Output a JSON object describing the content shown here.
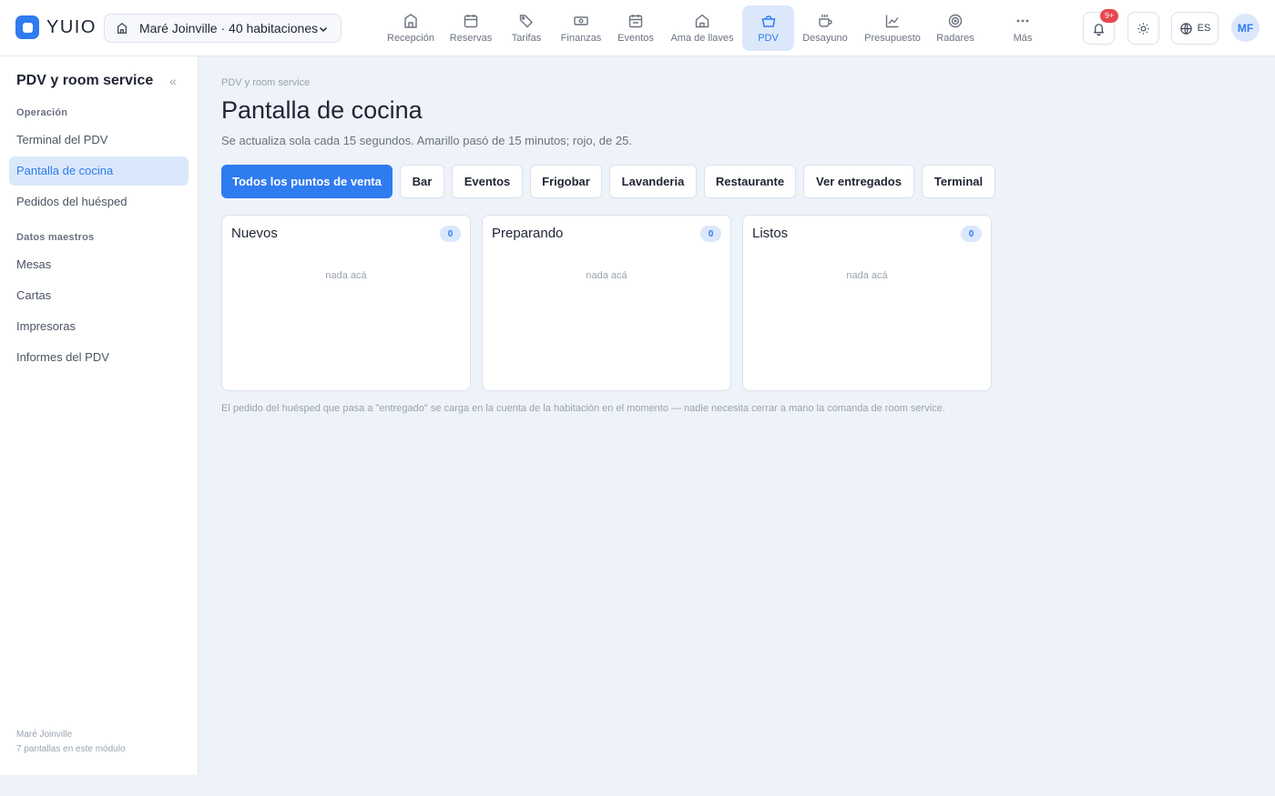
{
  "app": {
    "logo_text": "YUIO"
  },
  "hotel_selector": {
    "label": "Maré Joinville · 40 habitaciones"
  },
  "nav": [
    {
      "label": "Recepción",
      "icon": "building-icon"
    },
    {
      "label": "Reservas",
      "icon": "calendar-icon"
    },
    {
      "label": "Tarifas",
      "icon": "tag-icon"
    },
    {
      "label": "Finanzas",
      "icon": "banknote-icon"
    },
    {
      "label": "Eventos",
      "icon": "calendar-event-icon"
    },
    {
      "label": "Ama de llaves",
      "icon": "house-icon"
    },
    {
      "label": "PDV",
      "icon": "basket-icon",
      "active": true
    },
    {
      "label": "Desayuno",
      "icon": "coffee-icon"
    },
    {
      "label": "Presupuesto",
      "icon": "chart-line-icon"
    },
    {
      "label": "Radares",
      "icon": "target-icon"
    },
    {
      "label": "Más",
      "icon": "dots-icon"
    }
  ],
  "header_actions": {
    "notifications_badge": "9+",
    "language": "ES",
    "avatar_initials": "MF"
  },
  "sidebar": {
    "title": "PDV y room service",
    "collapse_glyph": "«",
    "sections": [
      {
        "heading": "Operación",
        "items": [
          "Terminal del PDV",
          "Pantalla de cocina",
          "Pedidos del huésped"
        ]
      },
      {
        "heading": "Datos maestros",
        "items": [
          "Mesas",
          "Cartas",
          "Impresoras",
          "Informes del PDV"
        ]
      }
    ],
    "active_item": "Pantalla de cocina",
    "footer": {
      "hotel": "Maré Joinville",
      "screens": "7 pantallas en este módulo"
    }
  },
  "main": {
    "breadcrumb": "PDV y room service",
    "title": "Pantalla de cocina",
    "subtitle": "Se actualiza sola cada 15 segundos. Amarillo pasó de 15 minutos; rojo, de 25.",
    "filters": [
      "Todos los puntos de venta",
      "Bar",
      "Eventos",
      "Frigobar",
      "Lavanderia",
      "Restaurante",
      "Ver entregados",
      "Terminal"
    ],
    "active_filter": "Todos los puntos de venta",
    "columns": [
      {
        "title": "Nuevos",
        "count": "0",
        "empty_text": "nada acá"
      },
      {
        "title": "Preparando",
        "count": "0",
        "empty_text": "nada acá"
      },
      {
        "title": "Listos",
        "count": "0",
        "empty_text": "nada acá"
      }
    ],
    "footnote": "El pedido del huésped que pasa a \"entregado\" se carga en la cuenta de la habitación en el momento — nadie necesita cerrar a mano la comanda de room service."
  },
  "colors": {
    "accent": "#2f7bf0",
    "accent_soft": "#dbe8fb",
    "badge": "#e5484d",
    "background": "#eef2f9"
  }
}
